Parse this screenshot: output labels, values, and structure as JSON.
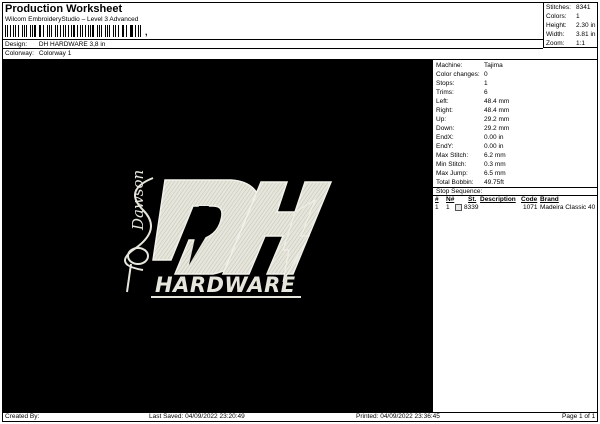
{
  "header": {
    "title": "Production Worksheet",
    "subtitle": "Wilcom EmbroideryStudio – Level 3 Advanced",
    "design_label": "Design:",
    "design_value": "DH HARDWARE 3,8 in",
    "colorway_label": "Colorway:",
    "colorway_value": "Colorway 1"
  },
  "summary": {
    "stitches_label": "Stitches:",
    "stitches_value": "8341",
    "colors_label": "Colors:",
    "colors_value": "1",
    "height_label": "Height:",
    "height_value": "2.30 in",
    "width_label": "Width:",
    "width_value": "3.81 in",
    "zoom_label": "Zoom:",
    "zoom_value": "1:1"
  },
  "machine_info": [
    {
      "k": "Machine:",
      "v": "Tajima"
    },
    {
      "k": "Color changes:",
      "v": "0"
    },
    {
      "k": "Stops:",
      "v": "1"
    },
    {
      "k": "Trims:",
      "v": "6"
    },
    {
      "k": "Left:",
      "v": "48.4 mm"
    },
    {
      "k": "Right:",
      "v": "48.4 mm"
    },
    {
      "k": "Up:",
      "v": "29.2 mm"
    },
    {
      "k": "Down:",
      "v": "29.2 mm"
    },
    {
      "k": "EndX:",
      "v": "0.00 in"
    },
    {
      "k": "EndY:",
      "v": "0.00 in"
    },
    {
      "k": "Max Stitch:",
      "v": "6.2 mm"
    },
    {
      "k": "Min Stitch:",
      "v": "0.3 mm"
    },
    {
      "k": "Max Jump:",
      "v": "6.5 mm"
    },
    {
      "k": "Total Bobbin:",
      "v": "49.75ft"
    }
  ],
  "stop_sequence": {
    "heading": "Stop Sequence:",
    "columns": [
      "#",
      "N#",
      "St.",
      "Description",
      "Code",
      "Brand"
    ],
    "rows": [
      {
        "num": "1",
        "n": "1",
        "stitches": "8339",
        "description": "",
        "code": "1071",
        "brand": "Madeira Classic 40"
      }
    ]
  },
  "design_artwork": {
    "main_text": "DH",
    "sub_text": "HARDWARE",
    "signature": "Dawson",
    "colors": {
      "background": "#000000",
      "thread": "#e6e6dc"
    }
  },
  "footer": {
    "created_by": "Created By:",
    "last_saved": "Last Saved: 04/09/2022 23:20:49",
    "printed": "Printed: 04/09/2022 23:36:45",
    "page": "Page 1 of 1"
  }
}
